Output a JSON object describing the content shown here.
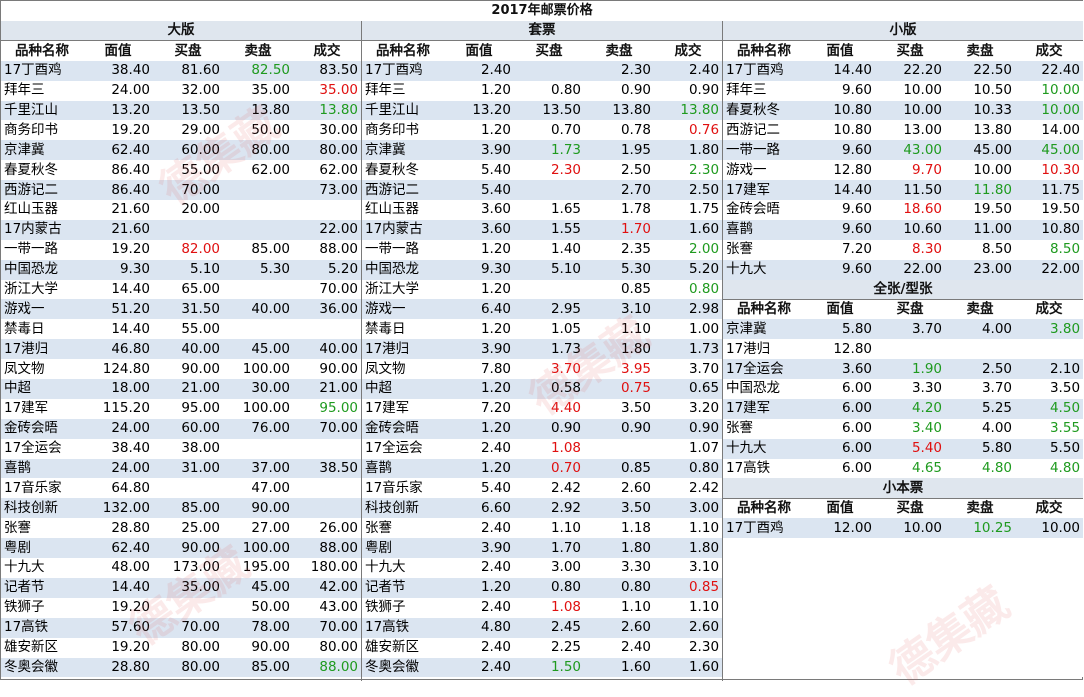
{
  "title": "2017年邮票价格",
  "columns": {
    "name": "品种名称",
    "face": "面值",
    "buy": "买盘",
    "sell": "卖盘",
    "deal": "成交"
  },
  "dealColumns": {
    "name": "品种名称",
    "face": "面值",
    "buy": "买盘",
    "sell": "卖盘",
    "deal": "成交"
  },
  "sections": {
    "large": "大版",
    "set": "套票",
    "small": "小版",
    "single": "全张/型张",
    "booklet": "小本票"
  },
  "watermark": "德集藏",
  "colors": {
    "green": "#1f9a1f",
    "red": "#e01010"
  },
  "large": [
    [
      "17丁酉鸡",
      "38.40",
      "81.60",
      "82.50",
      "83.50",
      "",
      "",
      "green",
      ""
    ],
    [
      "拜年三",
      "24.00",
      "32.00",
      "35.00",
      "35.00",
      "",
      "",
      "",
      "red"
    ],
    [
      "千里江山",
      "13.20",
      "13.50",
      "13.80",
      "13.80",
      "",
      "",
      "",
      "green"
    ],
    [
      "商务印书",
      "19.20",
      "29.00",
      "50.00",
      "30.00",
      "",
      "",
      "",
      ""
    ],
    [
      "京津冀",
      "62.40",
      "60.00",
      "80.00",
      "80.00",
      "",
      "",
      "",
      ""
    ],
    [
      "春夏秋冬",
      "86.40",
      "55.00",
      "62.00",
      "62.00",
      "",
      "",
      "",
      ""
    ],
    [
      "西游记二",
      "86.40",
      "70.00",
      "",
      "73.00",
      "",
      "",
      "",
      ""
    ],
    [
      "红山玉器",
      "21.60",
      "20.00",
      "",
      "",
      "",
      "",
      "",
      ""
    ],
    [
      "17内蒙古",
      "21.60",
      "",
      "",
      "22.00",
      "",
      "",
      "",
      ""
    ],
    [
      "一带一路",
      "19.20",
      "82.00",
      "85.00",
      "88.00",
      "",
      "red",
      "",
      ""
    ],
    [
      "中国恐龙",
      "9.30",
      "5.10",
      "5.30",
      "5.20",
      "",
      "",
      "",
      ""
    ],
    [
      "浙江大学",
      "14.40",
      "65.00",
      "",
      "70.00",
      "",
      "",
      "",
      ""
    ],
    [
      "游戏一",
      "51.20",
      "31.50",
      "40.00",
      "36.00",
      "",
      "",
      "",
      ""
    ],
    [
      "禁毒日",
      "14.40",
      "55.00",
      "",
      "",
      "",
      "",
      "",
      ""
    ],
    [
      "17港归",
      "46.80",
      "40.00",
      "45.00",
      "40.00",
      "",
      "",
      "",
      ""
    ],
    [
      "凤文物",
      "124.80",
      "90.00",
      "100.00",
      "90.00",
      "",
      "",
      "",
      ""
    ],
    [
      "中超",
      "18.00",
      "21.00",
      "30.00",
      "21.00",
      "",
      "",
      "",
      ""
    ],
    [
      "17建军",
      "115.20",
      "95.00",
      "100.00",
      "95.00",
      "",
      "",
      "",
      "green"
    ],
    [
      "金砖会晤",
      "24.00",
      "60.00",
      "76.00",
      "70.00",
      "",
      "",
      "",
      ""
    ],
    [
      "17全运会",
      "38.40",
      "38.00",
      "",
      "",
      "",
      "",
      "",
      ""
    ],
    [
      "喜鹊",
      "24.00",
      "31.00",
      "37.00",
      "38.50",
      "",
      "",
      "",
      ""
    ],
    [
      "17音乐家",
      "64.80",
      "",
      "47.00",
      "",
      "",
      "",
      "",
      ""
    ],
    [
      "科技创新",
      "132.00",
      "85.00",
      "90.00",
      "",
      "",
      "",
      "",
      ""
    ],
    [
      "张謇",
      "28.80",
      "25.00",
      "27.00",
      "26.00",
      "",
      "",
      "",
      ""
    ],
    [
      "粤剧",
      "62.40",
      "90.00",
      "100.00",
      "88.00",
      "",
      "",
      "",
      ""
    ],
    [
      "十九大",
      "48.00",
      "173.00",
      "195.00",
      "180.00",
      "",
      "",
      "",
      ""
    ],
    [
      "记者节",
      "14.40",
      "35.00",
      "45.00",
      "42.00",
      "",
      "",
      "",
      ""
    ],
    [
      "铁狮子",
      "19.20",
      "",
      "50.00",
      "43.00",
      "",
      "",
      "",
      ""
    ],
    [
      "17高铁",
      "57.60",
      "70.00",
      "78.00",
      "70.00",
      "",
      "",
      "",
      ""
    ],
    [
      "雄安新区",
      "19.20",
      "80.00",
      "90.00",
      "80.00",
      "",
      "",
      "",
      ""
    ],
    [
      "冬奥会徽",
      "28.80",
      "80.00",
      "85.00",
      "88.00",
      "",
      "",
      "",
      "green"
    ]
  ],
  "set": [
    [
      "17丁酉鸡",
      "2.40",
      "",
      "2.30",
      "2.40",
      "",
      "",
      "",
      ""
    ],
    [
      "拜年三",
      "1.20",
      "0.80",
      "0.90",
      "0.90",
      "",
      "",
      "",
      ""
    ],
    [
      "千里江山",
      "13.20",
      "13.50",
      "13.80",
      "13.80",
      "",
      "",
      "",
      "green"
    ],
    [
      "商务印书",
      "1.20",
      "0.70",
      "0.78",
      "0.76",
      "",
      "",
      "",
      "red"
    ],
    [
      "京津冀",
      "3.90",
      "1.73",
      "1.95",
      "1.80",
      "",
      "green",
      "",
      ""
    ],
    [
      "春夏秋冬",
      "5.40",
      "2.30",
      "2.50",
      "2.30",
      "",
      "red",
      "",
      "green"
    ],
    [
      "西游记二",
      "5.40",
      "",
      "2.70",
      "2.50",
      "",
      "",
      "",
      ""
    ],
    [
      "红山玉器",
      "3.60",
      "1.65",
      "1.78",
      "1.75",
      "",
      "",
      "",
      ""
    ],
    [
      "17内蒙古",
      "3.60",
      "1.55",
      "1.70",
      "1.60",
      "",
      "",
      "red",
      ""
    ],
    [
      "一带一路",
      "1.20",
      "1.40",
      "2.35",
      "2.00",
      "",
      "",
      "",
      "green"
    ],
    [
      "中国恐龙",
      "9.30",
      "5.10",
      "5.30",
      "5.20",
      "",
      "",
      "",
      ""
    ],
    [
      "浙江大学",
      "1.20",
      "",
      "0.85",
      "0.80",
      "",
      "",
      "",
      "green"
    ],
    [
      "游戏一",
      "6.40",
      "2.95",
      "3.10",
      "2.98",
      "",
      "",
      "",
      ""
    ],
    [
      "禁毒日",
      "1.20",
      "1.05",
      "1.10",
      "1.00",
      "",
      "",
      "",
      ""
    ],
    [
      "17港归",
      "3.90",
      "1.73",
      "1.80",
      "1.73",
      "",
      "",
      "",
      ""
    ],
    [
      "凤文物",
      "7.80",
      "3.70",
      "3.95",
      "3.70",
      "",
      "red",
      "red",
      ""
    ],
    [
      "中超",
      "1.20",
      "0.58",
      "0.75",
      "0.65",
      "",
      "",
      "red",
      ""
    ],
    [
      "17建军",
      "7.20",
      "4.40",
      "3.50",
      "3.20",
      "",
      "red",
      "",
      ""
    ],
    [
      "金砖会晤",
      "1.20",
      "0.90",
      "0.90",
      "0.90",
      "",
      "",
      "",
      ""
    ],
    [
      "17全运会",
      "2.40",
      "1.08",
      "",
      "1.07",
      "",
      "red",
      "",
      ""
    ],
    [
      "喜鹊",
      "1.20",
      "0.70",
      "0.85",
      "0.80",
      "",
      "red",
      "",
      ""
    ],
    [
      "17音乐家",
      "5.40",
      "2.42",
      "2.60",
      "2.42",
      "",
      "",
      "",
      ""
    ],
    [
      "科技创新",
      "6.60",
      "2.92",
      "3.50",
      "3.00",
      "",
      "",
      "",
      ""
    ],
    [
      "张謇",
      "2.40",
      "1.10",
      "1.18",
      "1.10",
      "",
      "",
      "",
      ""
    ],
    [
      "粤剧",
      "3.90",
      "1.70",
      "1.80",
      "1.80",
      "",
      "",
      "",
      ""
    ],
    [
      "十九大",
      "2.40",
      "3.00",
      "3.30",
      "3.10",
      "",
      "",
      "",
      ""
    ],
    [
      "记者节",
      "1.20",
      "0.80",
      "0.80",
      "0.85",
      "",
      "",
      "",
      "red"
    ],
    [
      "铁狮子",
      "2.40",
      "1.08",
      "1.10",
      "1.10",
      "",
      "red",
      "",
      ""
    ],
    [
      "17高铁",
      "4.80",
      "2.45",
      "2.60",
      "2.60",
      "",
      "",
      "",
      ""
    ],
    [
      "雄安新区",
      "2.40",
      "2.25",
      "2.40",
      "2.30",
      "",
      "",
      "",
      ""
    ],
    [
      "冬奥会徽",
      "2.40",
      "1.50",
      "1.60",
      "1.60",
      "",
      "green",
      "",
      ""
    ]
  ],
  "small": [
    [
      "17丁酉鸡",
      "14.40",
      "22.20",
      "22.50",
      "22.40",
      "",
      "",
      "",
      ""
    ],
    [
      "拜年三",
      "9.60",
      "10.00",
      "10.50",
      "10.00",
      "",
      "",
      "",
      "green"
    ],
    [
      "春夏秋冬",
      "10.80",
      "10.00",
      "10.33",
      "10.00",
      "",
      "",
      "",
      "green"
    ],
    [
      "西游记二",
      "10.80",
      "13.00",
      "13.80",
      "14.00",
      "",
      "",
      "",
      ""
    ],
    [
      "一带一路",
      "9.60",
      "43.00",
      "45.00",
      "45.00",
      "",
      "green",
      "",
      "green"
    ],
    [
      "游戏一",
      "12.80",
      "9.70",
      "10.00",
      "10.30",
      "",
      "red",
      "",
      "red"
    ],
    [
      "17建军",
      "14.40",
      "11.50",
      "11.80",
      "11.75",
      "",
      "",
      "green",
      ""
    ],
    [
      "金砖会晤",
      "9.60",
      "18.60",
      "19.50",
      "19.50",
      "",
      "red",
      "",
      ""
    ],
    [
      "喜鹊",
      "9.60",
      "10.60",
      "11.00",
      "10.80",
      "",
      "",
      "",
      ""
    ],
    [
      "张謇",
      "7.20",
      "8.30",
      "8.50",
      "8.50",
      "",
      "red",
      "",
      "green"
    ],
    [
      "十九大",
      "9.60",
      "22.00",
      "23.00",
      "22.00",
      "",
      "",
      "",
      ""
    ]
  ],
  "single": [
    [
      "京津冀",
      "5.80",
      "3.70",
      "4.00",
      "3.80",
      "",
      "",
      "",
      "green"
    ],
    [
      "17港归",
      "12.80",
      "",
      "",
      "",
      "",
      "",
      "",
      ""
    ],
    [
      "17全运会",
      "3.60",
      "1.90",
      "2.50",
      "2.10",
      "",
      "green",
      "",
      ""
    ],
    [
      "中国恐龙",
      "6.00",
      "3.30",
      "3.70",
      "3.50",
      "",
      "",
      "",
      ""
    ],
    [
      "17建军",
      "6.00",
      "4.20",
      "5.25",
      "4.50",
      "",
      "green",
      "",
      "green"
    ],
    [
      "张謇",
      "6.00",
      "3.40",
      "4.00",
      "3.55",
      "",
      "green",
      "",
      "green"
    ],
    [
      "十九大",
      "6.00",
      "5.40",
      "5.80",
      "5.50",
      "",
      "red",
      "",
      ""
    ],
    [
      "17高铁",
      "6.00",
      "4.65",
      "4.80",
      "4.80",
      "",
      "green",
      "green",
      "green"
    ]
  ],
  "booklet": [
    [
      "17丁酉鸡",
      "12.00",
      "10.00",
      "10.25",
      "10.00",
      "",
      "",
      "green",
      ""
    ]
  ]
}
